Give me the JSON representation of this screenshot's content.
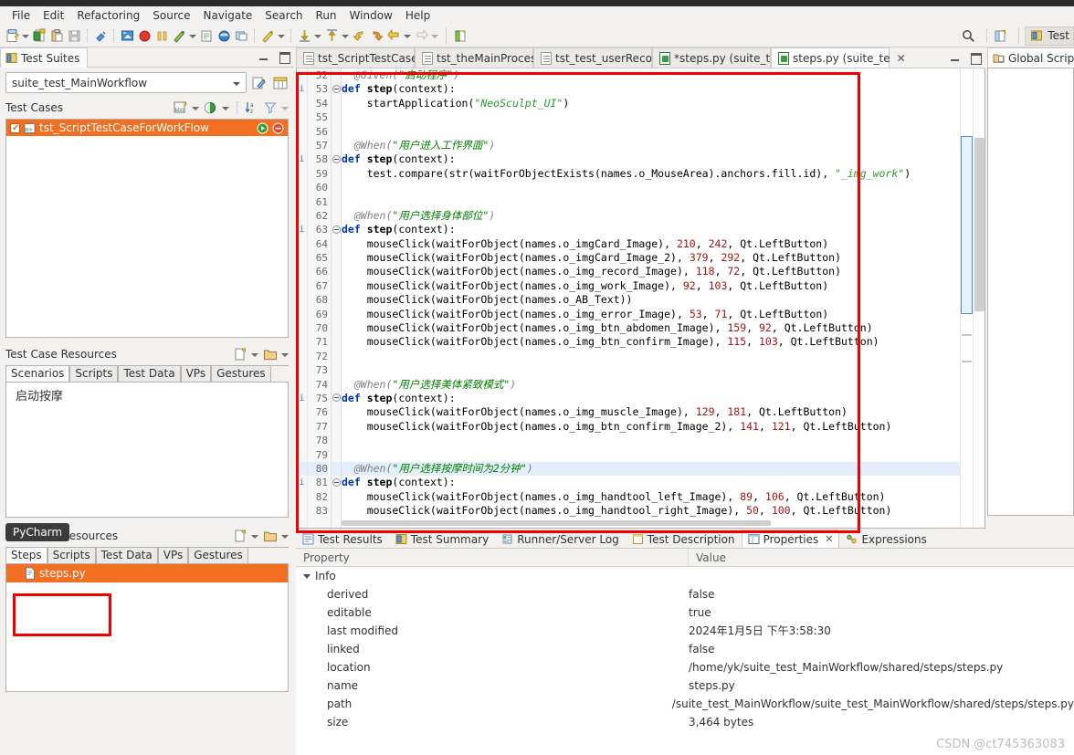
{
  "menu": {
    "items": [
      "File",
      "Edit",
      "Refactoring",
      "Source",
      "Navigate",
      "Search",
      "Run",
      "Window",
      "Help"
    ]
  },
  "toolbar": {
    "icons": [
      "new-document-icon",
      "new-document-dropdown",
      "open-test-case-icon",
      "paste-test-case-icon",
      "save-icon",
      "eraser-icon",
      "record-screen-icon",
      "record-icon",
      "pause-icon",
      "pick-object-icon",
      "pick-object-dropdown",
      "spy-icon",
      "inspect-icon",
      "window-icon",
      "run-icon",
      "run-dropdown",
      "step-into-icon",
      "step-into-dropdown",
      "step-over-icon",
      "step-over-dropdown",
      "back-icon",
      "forward-icon",
      "prev-icon",
      "prev-dropdown",
      "next-icon",
      "next-dropdown",
      "new-perspective-icon"
    ],
    "search_icon": "search-icon",
    "perspective_icon": "open-perspective-icon",
    "perspective_label": "Test"
  },
  "left_panel": {
    "tab_label": "Test Suites",
    "tab_icon": "test-suite-icon",
    "suite_combo_value": "suite_test_MainWorkflow",
    "suite_tool_icons": [
      "edit-suite-icon",
      "suite-settings-icon"
    ],
    "test_cases": {
      "header": "Test Cases",
      "tool_icons": [
        "new-bdd-test-case-icon",
        "new-bdd-dropdown",
        "new-test-case-icon",
        "new-test-case-dropdown",
        "sort-az-icon",
        "filter-icon",
        "filter-dropdown"
      ],
      "rows": [
        {
          "checked": true,
          "icon": "bdd-test-case-icon",
          "label": "tst_ScriptTestCaseForWorkFlow",
          "selected": true,
          "run_icon": "run-test-icon",
          "stop_icon": "stop-test-icon"
        }
      ]
    },
    "test_case_resources": {
      "header": "Test Case Resources",
      "tool_icons": [
        "new-file-icon",
        "new-file-dropdown",
        "new-folder-icon",
        "new-folder-dropdown"
      ],
      "tabs": [
        "Scenarios",
        "Scripts",
        "Test Data",
        "VPs",
        "Gestures"
      ],
      "active_tab": "Scenarios",
      "items": [
        "启动按摩"
      ]
    },
    "test_suite_resources": {
      "header": "Test Suite Resources",
      "tool_icons": [
        "new-file-icon",
        "new-file-dropdown",
        "new-folder-icon",
        "new-folder-dropdown"
      ],
      "tabs": [
        "Steps",
        "Scripts",
        "Test Data",
        "VPs",
        "Gestures"
      ],
      "active_tab": "Steps",
      "items": [
        {
          "icon": "python-file-icon",
          "label": "steps.py",
          "selected": true
        }
      ]
    },
    "pycharm_badge": "PyCharm"
  },
  "editor": {
    "tabs": [
      {
        "label": "tst_ScriptTestCase",
        "icon": "text-file-icon",
        "active": false,
        "closable": false
      },
      {
        "label": "tst_theMainProcess",
        "icon": "text-file-icon",
        "active": false,
        "closable": false
      },
      {
        "label": "tst_test_userRecor",
        "icon": "text-file-icon",
        "active": false,
        "closable": false
      },
      {
        "label": "*steps.py (suite_t",
        "icon": "python-file-icon",
        "active": false,
        "closable": false
      },
      {
        "label": "steps.py (suite_te",
        "icon": "python-file-icon",
        "active": true,
        "closable": true
      }
    ],
    "first_line_number": 52,
    "lines": [
      {
        "n": 52,
        "ann": "",
        "fold": "",
        "hl": false,
        "tokens": [
          {
            "t": "  ",
            "c": "tok-plain"
          },
          {
            "t": "@Given(",
            "c": "tok-dec"
          },
          {
            "t": "\"启动程序\"",
            "c": "tok-str"
          },
          {
            "t": ")",
            "c": "tok-dec"
          }
        ]
      },
      {
        "n": 53,
        "ann": "i",
        "fold": "-",
        "hl": false,
        "tokens": [
          {
            "t": "def ",
            "c": "tok-kw"
          },
          {
            "t": "step",
            "c": "tok-def"
          },
          {
            "t": "(context):",
            "c": "tok-plain"
          }
        ]
      },
      {
        "n": 54,
        "ann": "",
        "fold": "",
        "hl": false,
        "tokens": [
          {
            "t": "    startApplication(",
            "c": "tok-plain"
          },
          {
            "t": "\"NeoSculpt_UI\"",
            "c": "tok-str2"
          },
          {
            "t": ")",
            "c": "tok-plain"
          }
        ]
      },
      {
        "n": 55,
        "ann": "",
        "fold": "",
        "hl": false,
        "tokens": []
      },
      {
        "n": 56,
        "ann": "",
        "fold": "",
        "hl": false,
        "tokens": []
      },
      {
        "n": 57,
        "ann": "",
        "fold": "",
        "hl": false,
        "tokens": [
          {
            "t": "  ",
            "c": "tok-plain"
          },
          {
            "t": "@When(",
            "c": "tok-dec"
          },
          {
            "t": "\"用户进入工作界面\"",
            "c": "tok-str"
          },
          {
            "t": ")",
            "c": "tok-dec"
          }
        ]
      },
      {
        "n": 58,
        "ann": "i",
        "fold": "-",
        "hl": false,
        "tokens": [
          {
            "t": "def ",
            "c": "tok-kw"
          },
          {
            "t": "step",
            "c": "tok-def"
          },
          {
            "t": "(context):",
            "c": "tok-plain"
          }
        ]
      },
      {
        "n": 59,
        "ann": "",
        "fold": "",
        "hl": false,
        "tokens": [
          {
            "t": "    test.compare(str(waitForObjectExists(names.o_MouseArea).anchors.fill.id), ",
            "c": "tok-plain"
          },
          {
            "t": "\"_img_work\"",
            "c": "tok-str2"
          },
          {
            "t": ")",
            "c": "tok-plain"
          }
        ]
      },
      {
        "n": 60,
        "ann": "",
        "fold": "",
        "hl": false,
        "tokens": []
      },
      {
        "n": 61,
        "ann": "",
        "fold": "",
        "hl": false,
        "tokens": []
      },
      {
        "n": 62,
        "ann": "",
        "fold": "",
        "hl": false,
        "tokens": [
          {
            "t": "  ",
            "c": "tok-plain"
          },
          {
            "t": "@When(",
            "c": "tok-dec"
          },
          {
            "t": "\"用户选择身体部位\"",
            "c": "tok-str"
          },
          {
            "t": ")",
            "c": "tok-dec"
          }
        ]
      },
      {
        "n": 63,
        "ann": "i",
        "fold": "-",
        "hl": false,
        "tokens": [
          {
            "t": "def ",
            "c": "tok-kw"
          },
          {
            "t": "step",
            "c": "tok-def"
          },
          {
            "t": "(context):",
            "c": "tok-plain"
          }
        ]
      },
      {
        "n": 64,
        "ann": "",
        "fold": "",
        "hl": false,
        "tokens": [
          {
            "t": "    mouseClick(waitForObject(names.o_imgCard_Image), ",
            "c": "tok-plain"
          },
          {
            "t": "210",
            "c": "tok-num"
          },
          {
            "t": ", ",
            "c": "tok-plain"
          },
          {
            "t": "242",
            "c": "tok-num"
          },
          {
            "t": ", Qt.LeftButton)",
            "c": "tok-plain"
          }
        ]
      },
      {
        "n": 65,
        "ann": "",
        "fold": "",
        "hl": false,
        "tokens": [
          {
            "t": "    mouseClick(waitForObject(names.o_imgCard_Image_2), ",
            "c": "tok-plain"
          },
          {
            "t": "379",
            "c": "tok-num"
          },
          {
            "t": ", ",
            "c": "tok-plain"
          },
          {
            "t": "292",
            "c": "tok-num"
          },
          {
            "t": ", Qt.LeftButton)",
            "c": "tok-plain"
          }
        ]
      },
      {
        "n": 66,
        "ann": "",
        "fold": "",
        "hl": false,
        "tokens": [
          {
            "t": "    mouseClick(waitForObject(names.o_img_record_Image), ",
            "c": "tok-plain"
          },
          {
            "t": "118",
            "c": "tok-num"
          },
          {
            "t": ", ",
            "c": "tok-plain"
          },
          {
            "t": "72",
            "c": "tok-num"
          },
          {
            "t": ", Qt.LeftButton)",
            "c": "tok-plain"
          }
        ]
      },
      {
        "n": 67,
        "ann": "",
        "fold": "",
        "hl": false,
        "tokens": [
          {
            "t": "    mouseClick(waitForObject(names.o_img_work_Image), ",
            "c": "tok-plain"
          },
          {
            "t": "92",
            "c": "tok-num"
          },
          {
            "t": ", ",
            "c": "tok-plain"
          },
          {
            "t": "103",
            "c": "tok-num"
          },
          {
            "t": ", Qt.LeftButton)",
            "c": "tok-plain"
          }
        ]
      },
      {
        "n": 68,
        "ann": "",
        "fold": "",
        "hl": false,
        "tokens": [
          {
            "t": "    mouseClick(waitForObject(names.o_AB_Text))",
            "c": "tok-plain"
          }
        ]
      },
      {
        "n": 69,
        "ann": "",
        "fold": "",
        "hl": false,
        "tokens": [
          {
            "t": "    mouseClick(waitForObject(names.o_img_error_Image), ",
            "c": "tok-plain"
          },
          {
            "t": "53",
            "c": "tok-num"
          },
          {
            "t": ", ",
            "c": "tok-plain"
          },
          {
            "t": "71",
            "c": "tok-num"
          },
          {
            "t": ", Qt.LeftButton)",
            "c": "tok-plain"
          }
        ]
      },
      {
        "n": 70,
        "ann": "",
        "fold": "",
        "hl": false,
        "tokens": [
          {
            "t": "    mouseClick(waitForObject(names.o_img_btn_abdomen_Image), ",
            "c": "tok-plain"
          },
          {
            "t": "159",
            "c": "tok-num"
          },
          {
            "t": ", ",
            "c": "tok-plain"
          },
          {
            "t": "92",
            "c": "tok-num"
          },
          {
            "t": ", Qt.LeftButton)",
            "c": "tok-plain"
          }
        ]
      },
      {
        "n": 71,
        "ann": "",
        "fold": "",
        "hl": false,
        "tokens": [
          {
            "t": "    mouseClick(waitForObject(names.o_img_btn_confirm_Image), ",
            "c": "tok-plain"
          },
          {
            "t": "115",
            "c": "tok-num"
          },
          {
            "t": ", ",
            "c": "tok-plain"
          },
          {
            "t": "103",
            "c": "tok-num"
          },
          {
            "t": ", Qt.LeftButton)",
            "c": "tok-plain"
          }
        ]
      },
      {
        "n": 72,
        "ann": "",
        "fold": "",
        "hl": false,
        "tokens": []
      },
      {
        "n": 73,
        "ann": "",
        "fold": "",
        "hl": false,
        "tokens": []
      },
      {
        "n": 74,
        "ann": "",
        "fold": "",
        "hl": false,
        "tokens": [
          {
            "t": "  ",
            "c": "tok-plain"
          },
          {
            "t": "@When(",
            "c": "tok-dec"
          },
          {
            "t": "\"用户选择美体紧致模式\"",
            "c": "tok-str"
          },
          {
            "t": ")",
            "c": "tok-dec"
          }
        ]
      },
      {
        "n": 75,
        "ann": "i",
        "fold": "-",
        "hl": false,
        "tokens": [
          {
            "t": "def ",
            "c": "tok-kw"
          },
          {
            "t": "step",
            "c": "tok-def"
          },
          {
            "t": "(context):",
            "c": "tok-plain"
          }
        ]
      },
      {
        "n": 76,
        "ann": "",
        "fold": "",
        "hl": false,
        "tokens": [
          {
            "t": "    mouseClick(waitForObject(names.o_img_muscle_Image), ",
            "c": "tok-plain"
          },
          {
            "t": "129",
            "c": "tok-num"
          },
          {
            "t": ", ",
            "c": "tok-plain"
          },
          {
            "t": "181",
            "c": "tok-num"
          },
          {
            "t": ", Qt.LeftButton)",
            "c": "tok-plain"
          }
        ]
      },
      {
        "n": 77,
        "ann": "",
        "fold": "",
        "hl": false,
        "tokens": [
          {
            "t": "    mouseClick(waitForObject(names.o_img_btn_confirm_Image_2), ",
            "c": "tok-plain"
          },
          {
            "t": "141",
            "c": "tok-num"
          },
          {
            "t": ", ",
            "c": "tok-plain"
          },
          {
            "t": "121",
            "c": "tok-num"
          },
          {
            "t": ", Qt.LeftButton)",
            "c": "tok-plain"
          }
        ]
      },
      {
        "n": 78,
        "ann": "",
        "fold": "",
        "hl": false,
        "tokens": []
      },
      {
        "n": 79,
        "ann": "",
        "fold": "",
        "hl": false,
        "tokens": []
      },
      {
        "n": 80,
        "ann": "",
        "fold": "",
        "hl": true,
        "tokens": [
          {
            "t": "  ",
            "c": "tok-plain"
          },
          {
            "t": "@When(",
            "c": "tok-dec"
          },
          {
            "t": "\"用户选择按摩时间为2分钟\"",
            "c": "tok-str"
          },
          {
            "t": ")",
            "c": "tok-dec"
          }
        ]
      },
      {
        "n": 81,
        "ann": "i",
        "fold": "-",
        "hl": false,
        "tokens": [
          {
            "t": "def ",
            "c": "tok-kw"
          },
          {
            "t": "step",
            "c": "tok-def"
          },
          {
            "t": "(context):",
            "c": "tok-plain"
          }
        ]
      },
      {
        "n": 82,
        "ann": "",
        "fold": "",
        "hl": false,
        "tokens": [
          {
            "t": "    mouseClick(waitForObject(names.o_img_handtool_left_Image), ",
            "c": "tok-plain"
          },
          {
            "t": "89",
            "c": "tok-num"
          },
          {
            "t": ", ",
            "c": "tok-plain"
          },
          {
            "t": "106",
            "c": "tok-num"
          },
          {
            "t": ", Qt.LeftButton)",
            "c": "tok-plain"
          }
        ]
      },
      {
        "n": 83,
        "ann": "",
        "fold": "",
        "hl": false,
        "tokens": [
          {
            "t": "    mouseClick(waitForObject(names.o_img_handtool_right_Image), ",
            "c": "tok-plain"
          },
          {
            "t": "50",
            "c": "tok-num"
          },
          {
            "t": ", ",
            "c": "tok-plain"
          },
          {
            "t": "100",
            "c": "tok-num"
          },
          {
            "t": ", Qt.LeftButton)",
            "c": "tok-plain"
          }
        ]
      }
    ]
  },
  "right_dock": {
    "tab_label": "Global Scripts",
    "tab_icon": "global-scripts-icon"
  },
  "bottom_panel": {
    "tabs": [
      {
        "label": "Test Results",
        "icon": "test-results-icon",
        "active": false,
        "closable": false
      },
      {
        "label": "Test Summary",
        "icon": "test-summary-icon",
        "active": false,
        "closable": false
      },
      {
        "label": "Runner/Server Log",
        "icon": "runner-log-icon",
        "active": false,
        "closable": false
      },
      {
        "label": "Test Description",
        "icon": "test-description-icon",
        "active": false,
        "closable": false
      },
      {
        "label": "Properties",
        "icon": "properties-icon",
        "active": true,
        "closable": true
      },
      {
        "label": "Expressions",
        "icon": "expressions-icon",
        "active": false,
        "closable": false
      }
    ],
    "table": {
      "headers": [
        "Property",
        "Value"
      ],
      "group_label": "Info",
      "rows": [
        {
          "property": "derived",
          "value": "false"
        },
        {
          "property": "editable",
          "value": "true"
        },
        {
          "property": "last modified",
          "value": "2024年1月5日 下午3:58:30"
        },
        {
          "property": "linked",
          "value": "false"
        },
        {
          "property": "location",
          "value": "/home/yk/suite_test_MainWorkflow/shared/steps/steps.py"
        },
        {
          "property": "name",
          "value": "steps.py"
        },
        {
          "property": "path",
          "value": "/suite_test_MainWorkflow/suite_test_MainWorkflow/shared/steps/steps.py"
        },
        {
          "property": "size",
          "value": "3,464 bytes"
        }
      ]
    }
  },
  "watermark": "CSDN @ct745363083",
  "colors": {
    "selection_orange": "#f26f21",
    "annotation_red": "#f20000",
    "highlight_blue": "#e4eefb",
    "string_green": "#008000",
    "keyword_blue": "#0033b3",
    "number_red": "#a31515"
  }
}
